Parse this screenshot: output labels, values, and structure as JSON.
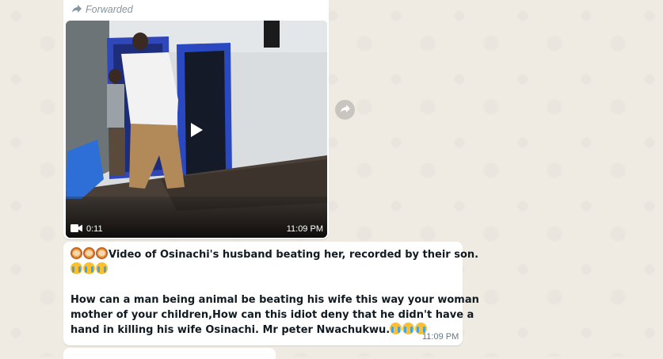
{
  "top_message": {
    "forwarded_label": "Forwarded",
    "video": {
      "duration": "0:11",
      "time": "11:09 PM",
      "icons": [
        "video-camera-icon",
        "play-icon",
        "forward-arrow-icon"
      ]
    }
  },
  "text_message": {
    "line1": "Video of Osinachi's husband beating her, recorded by their son.",
    "line3": "How can a man being animal be beating his wife this way your woman",
    "line4": "mother of your children,How can this idiot deny that he didn't have a",
    "line5": "hand in killing his wife Osinachi. Mr peter Nwachukwu.",
    "time": "11:09 PM",
    "emojis": [
      "woman-gesturing-icon",
      "crying-face-icon"
    ]
  },
  "colors": {
    "wallpaper": "#efeae2",
    "bubble": "#ffffff",
    "meta_text": "#667781",
    "forwarded_text": "#8696a0"
  }
}
